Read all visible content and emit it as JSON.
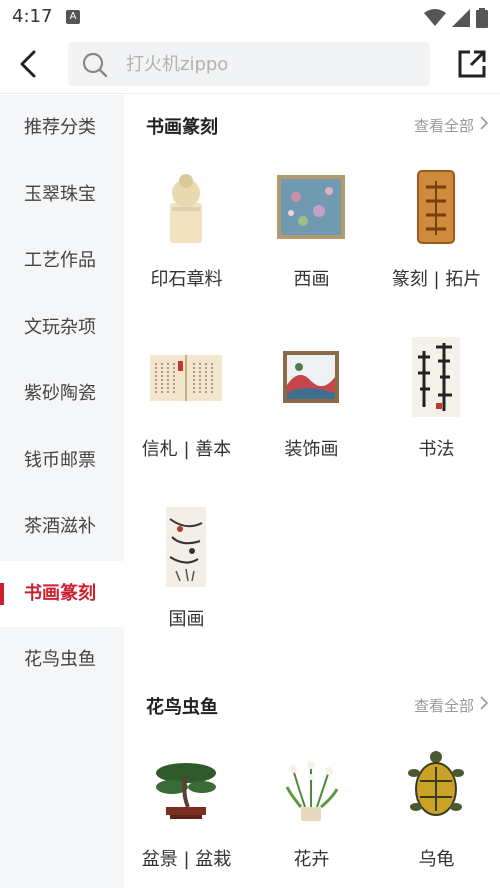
{
  "status": {
    "time": "4:17"
  },
  "search": {
    "placeholder": "打火机zippo"
  },
  "sidebar": {
    "items": [
      {
        "label": "推荐分类"
      },
      {
        "label": "玉翠珠宝"
      },
      {
        "label": "工艺作品"
      },
      {
        "label": "文玩杂项"
      },
      {
        "label": "紫砂陶瓷"
      },
      {
        "label": "钱币邮票"
      },
      {
        "label": "茶酒滋补"
      },
      {
        "label": "书画篆刻"
      },
      {
        "label": "花鸟虫鱼"
      }
    ],
    "active_index": 7
  },
  "sections": [
    {
      "title": "书画篆刻",
      "see_all": "查看全部",
      "items": [
        {
          "label": "印石章料",
          "icon": "seal-stone-icon"
        },
        {
          "label": "西画",
          "icon": "western-painting-icon"
        },
        {
          "label": "篆刻 | 拓片",
          "icon": "seal-carving-icon"
        },
        {
          "label": "信札 | 善本",
          "icon": "letter-book-icon"
        },
        {
          "label": "装饰画",
          "icon": "decorative-painting-icon"
        },
        {
          "label": "书法",
          "icon": "calligraphy-icon"
        },
        {
          "label": "国画",
          "icon": "chinese-painting-icon"
        }
      ]
    },
    {
      "title": "花鸟虫鱼",
      "see_all": "查看全部",
      "items": [
        {
          "label": "盆景 | 盆栽",
          "icon": "bonsai-icon"
        },
        {
          "label": "花卉",
          "icon": "flower-icon"
        },
        {
          "label": "乌龟",
          "icon": "turtle-icon"
        }
      ]
    }
  ],
  "colors": {
    "accent": "#cc1f2f",
    "sidebar_bg": "#f5f6f8"
  }
}
